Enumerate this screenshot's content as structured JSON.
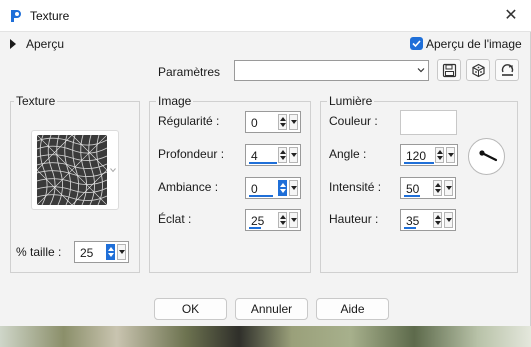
{
  "window": {
    "title": "Texture",
    "close_glyph": "✕"
  },
  "preview": {
    "label": "Aperçu",
    "checkbox_label": "Aperçu de l'image",
    "checkbox_checked": true
  },
  "params": {
    "label": "Paramètres",
    "value": ""
  },
  "texture_group": {
    "title": "Texture",
    "size_label": "% taille :",
    "size_value": "25"
  },
  "image_group": {
    "title": "Image",
    "fields": [
      {
        "label": "Régularité :",
        "value": "0"
      },
      {
        "label": "Profondeur :",
        "value": "4"
      },
      {
        "label": "Ambiance :",
        "value": "0"
      },
      {
        "label": "Éclat :",
        "value": "25"
      }
    ]
  },
  "light_group": {
    "title": "Lumière",
    "color_label": "Couleur :",
    "color_value": "#ffffff",
    "fields": [
      {
        "label": "Angle :",
        "value": "120"
      },
      {
        "label": "Intensité :",
        "value": "50"
      },
      {
        "label": "Hauteur :",
        "value": "35"
      }
    ]
  },
  "buttons": {
    "ok": "OK",
    "cancel": "Annuler",
    "help": "Aide"
  },
  "colors": {
    "accent": "#1f6fd8",
    "dialog_bg": "#f3f3f3"
  },
  "icons": [
    "app-icon",
    "close-icon",
    "expand-triangle-icon",
    "check-icon",
    "chevron-down-icon",
    "save-icon",
    "cube-icon",
    "reset-icon",
    "spin-arrows-icon"
  ]
}
